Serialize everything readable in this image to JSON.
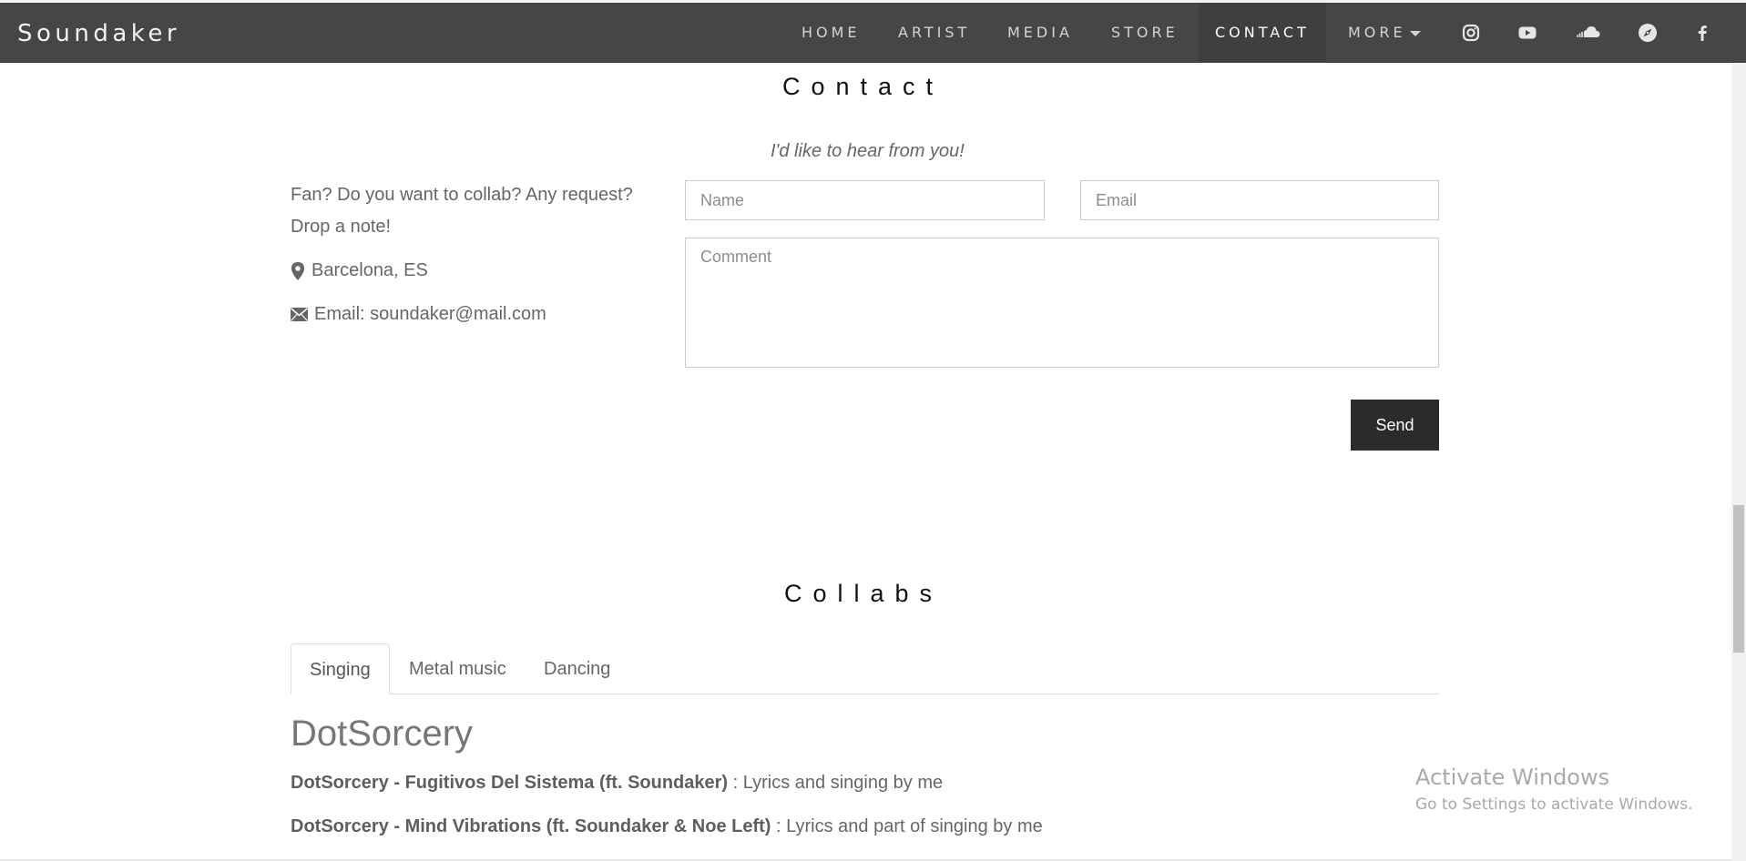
{
  "navbar": {
    "brand": "Soundaker",
    "items": [
      {
        "label": "HOME"
      },
      {
        "label": "ARTIST"
      },
      {
        "label": "MEDIA"
      },
      {
        "label": "STORE"
      },
      {
        "label": "CONTACT",
        "active": true
      },
      {
        "label": "MORE"
      }
    ],
    "social_icons": [
      "instagram-icon",
      "youtube-icon",
      "soundcloud-icon",
      "compass-icon",
      "facebook-icon"
    ]
  },
  "contact": {
    "title": "Contact",
    "tagline": "I'd like to hear from you!",
    "intro": "Fan? Do you want to collab? Any request? Drop a note!",
    "location": "Barcelona, ES",
    "email_line": "Email: soundaker@mail.com",
    "form": {
      "name_placeholder": "Name",
      "email_placeholder": "Email",
      "comment_placeholder": "Comment",
      "send_label": "Send"
    }
  },
  "collabs": {
    "title": "Collabs",
    "tabs": [
      {
        "label": "Singing",
        "active": true
      },
      {
        "label": "Metal music"
      },
      {
        "label": "Dancing"
      }
    ],
    "heading": "DotSorcery",
    "entries": [
      {
        "track": "DotSorcery - Fugitivos Del Sistema (ft. Soundaker)",
        "note": " : Lyrics and singing by me"
      },
      {
        "track": "DotSorcery - Mind Vibrations (ft. Soundaker & Noe Left)",
        "note": " : Lyrics and part of singing by me"
      }
    ]
  },
  "watermark": {
    "title": "Activate Windows",
    "subtitle": "Go to Settings to activate Windows."
  },
  "colors": {
    "navbar_bg": "#464646",
    "button_bg": "#2b2b2b",
    "text": "#666666"
  }
}
